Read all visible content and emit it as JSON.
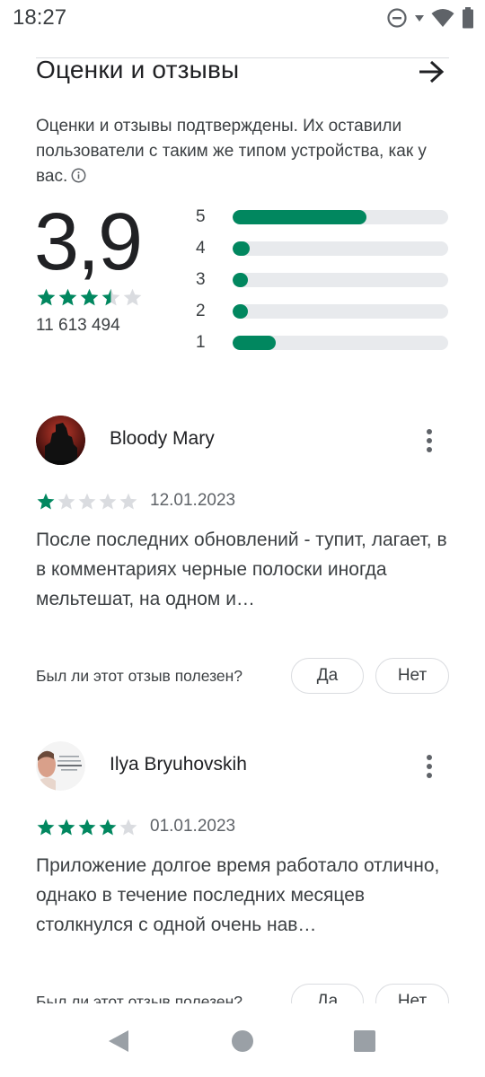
{
  "status_bar": {
    "time": "18:27",
    "icons": [
      "do-not-disturb-icon",
      "wifi-icon",
      "battery-icon"
    ]
  },
  "section": {
    "title": "Оценки и отзывы",
    "verified_text": "Оценки и отзывы подтверждены. Их оставили пользователи с таким же типом устройства, как у вас."
  },
  "summary": {
    "rating": "3,9",
    "stars": 3.5,
    "count": "11 613 494",
    "bars": [
      {
        "label": "5",
        "fraction": 0.62
      },
      {
        "label": "4",
        "fraction": 0.08
      },
      {
        "label": "3",
        "fraction": 0.07
      },
      {
        "label": "2",
        "fraction": 0.07
      },
      {
        "label": "1",
        "fraction": 0.2
      }
    ]
  },
  "reviews": [
    {
      "name": "Bloody Mary",
      "stars": 1,
      "date": "12.01.2023",
      "text": "После последних обновлений - тупит, лагает, в в комментариях черные полоски иногда мельтешат, на одном и…",
      "helpful_question": "Был ли этот отзыв полезен?",
      "yes_label": "Да",
      "no_label": "Нет"
    },
    {
      "name": "Ilya Bryuhovskih",
      "stars": 4,
      "date": "01.01.2023",
      "text": "Приложение долгое время работало отлично, однако в течение последних месяцев столкнулся с одной очень нав…",
      "helpful_question": "Был ли этот отзыв полезен?",
      "yes_label": "Да",
      "no_label": "Нет"
    }
  ],
  "colors": {
    "accent": "#01875f",
    "star_empty": "#dadce0",
    "track": "#e8eaed"
  },
  "nav": {
    "icons": [
      "back-icon",
      "home-icon",
      "recents-icon"
    ]
  }
}
